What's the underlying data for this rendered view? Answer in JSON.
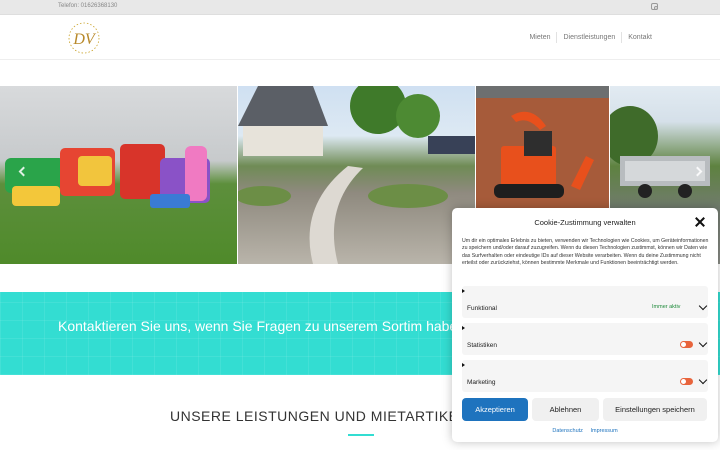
{
  "topbar": {
    "phone": "Telefon: 01626368130",
    "instagram_icon": "instagram-icon"
  },
  "header": {
    "logo_letters": "DV",
    "nav": [
      {
        "label": "Mieten"
      },
      {
        "label": "Dienstleistungen"
      },
      {
        "label": "Kontakt"
      }
    ]
  },
  "gallery": {
    "slides": [
      "bouncy-castles",
      "garden-path",
      "mini-excavator",
      "car-trailer"
    ],
    "prev_icon": "chevron-left-icon",
    "next_icon": "chevron-right-icon"
  },
  "band": {
    "text": "Kontaktieren Sie uns, wenn Sie Fragen zu unserem Sortim haben. Wir sind für Sie da."
  },
  "services": {
    "heading": "UNSERE LEISTUNGEN UND MIETARTIKEL"
  },
  "cookie": {
    "title": "Cookie-Zustimmung verwalten",
    "description": "Um dir ein optimales Erlebnis zu bieten, verwenden wir Technologien wie Cookies, um Geräteinformationen zu speichern und/oder darauf zuzugreifen. Wenn du diesen Technologien zustimmst, können wir Daten wie das Surfverhalten oder eindeutige IDs auf dieser Website verarbeiten. Wenn du deine Zustimmung nicht erteilst oder zurückziehst, können bestimmte Merkmale und Funktionen beeinträchtigt werden.",
    "categories": [
      {
        "label": "Funktional",
        "status": "Immer aktiv"
      },
      {
        "label": "Statistiken"
      },
      {
        "label": "Marketing"
      }
    ],
    "buttons": {
      "accept": "Akzeptieren",
      "deny": "Ablehnen",
      "prefs": "Einstellungen speichern"
    },
    "links": {
      "privacy": "Datenschutz",
      "imprint": "Impressum"
    },
    "colors": {
      "accent": "#1e73be",
      "toggle": "#e8643c",
      "band": "#33ddd2"
    }
  }
}
